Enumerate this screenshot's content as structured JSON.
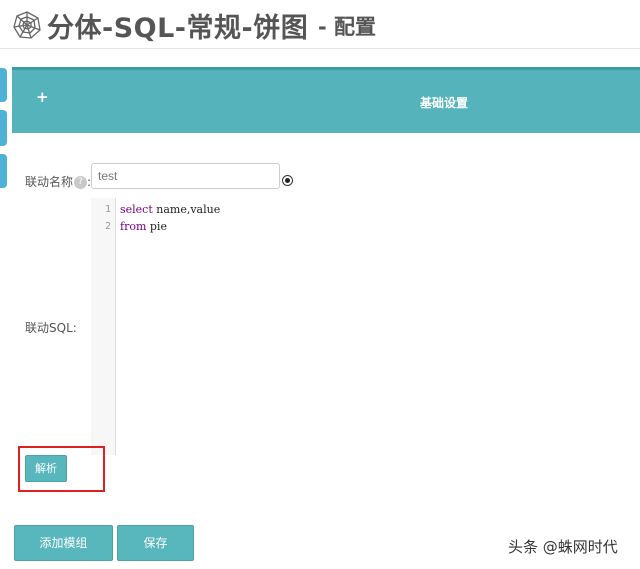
{
  "header": {
    "title": "分体-SQL-常规-饼图",
    "subtitle": "- 配置",
    "logo_icon": "spiderweb-icon"
  },
  "panel": {
    "expand_symbol": "+",
    "title": "基础设置"
  },
  "form": {
    "name_label": "联动名称",
    "name_label_suffix": ":",
    "help_icon": "?",
    "name_value": "test",
    "sql_label": "联动SQL:"
  },
  "editor": {
    "lines": [
      {
        "no": "1",
        "keyword": "select",
        "rest": " name,value"
      },
      {
        "no": "2",
        "keyword": "from",
        "rest": " pie"
      }
    ]
  },
  "buttons": {
    "parse": "解析",
    "add_module": "添加模组",
    "save": "保存"
  },
  "watermark": "头条 @蛛网时代",
  "colors": {
    "accent": "#55b3bb",
    "button": "#58b6bd",
    "highlight": "#e02020",
    "side_tab": "#4fb1d6",
    "keyword": "#770088"
  }
}
